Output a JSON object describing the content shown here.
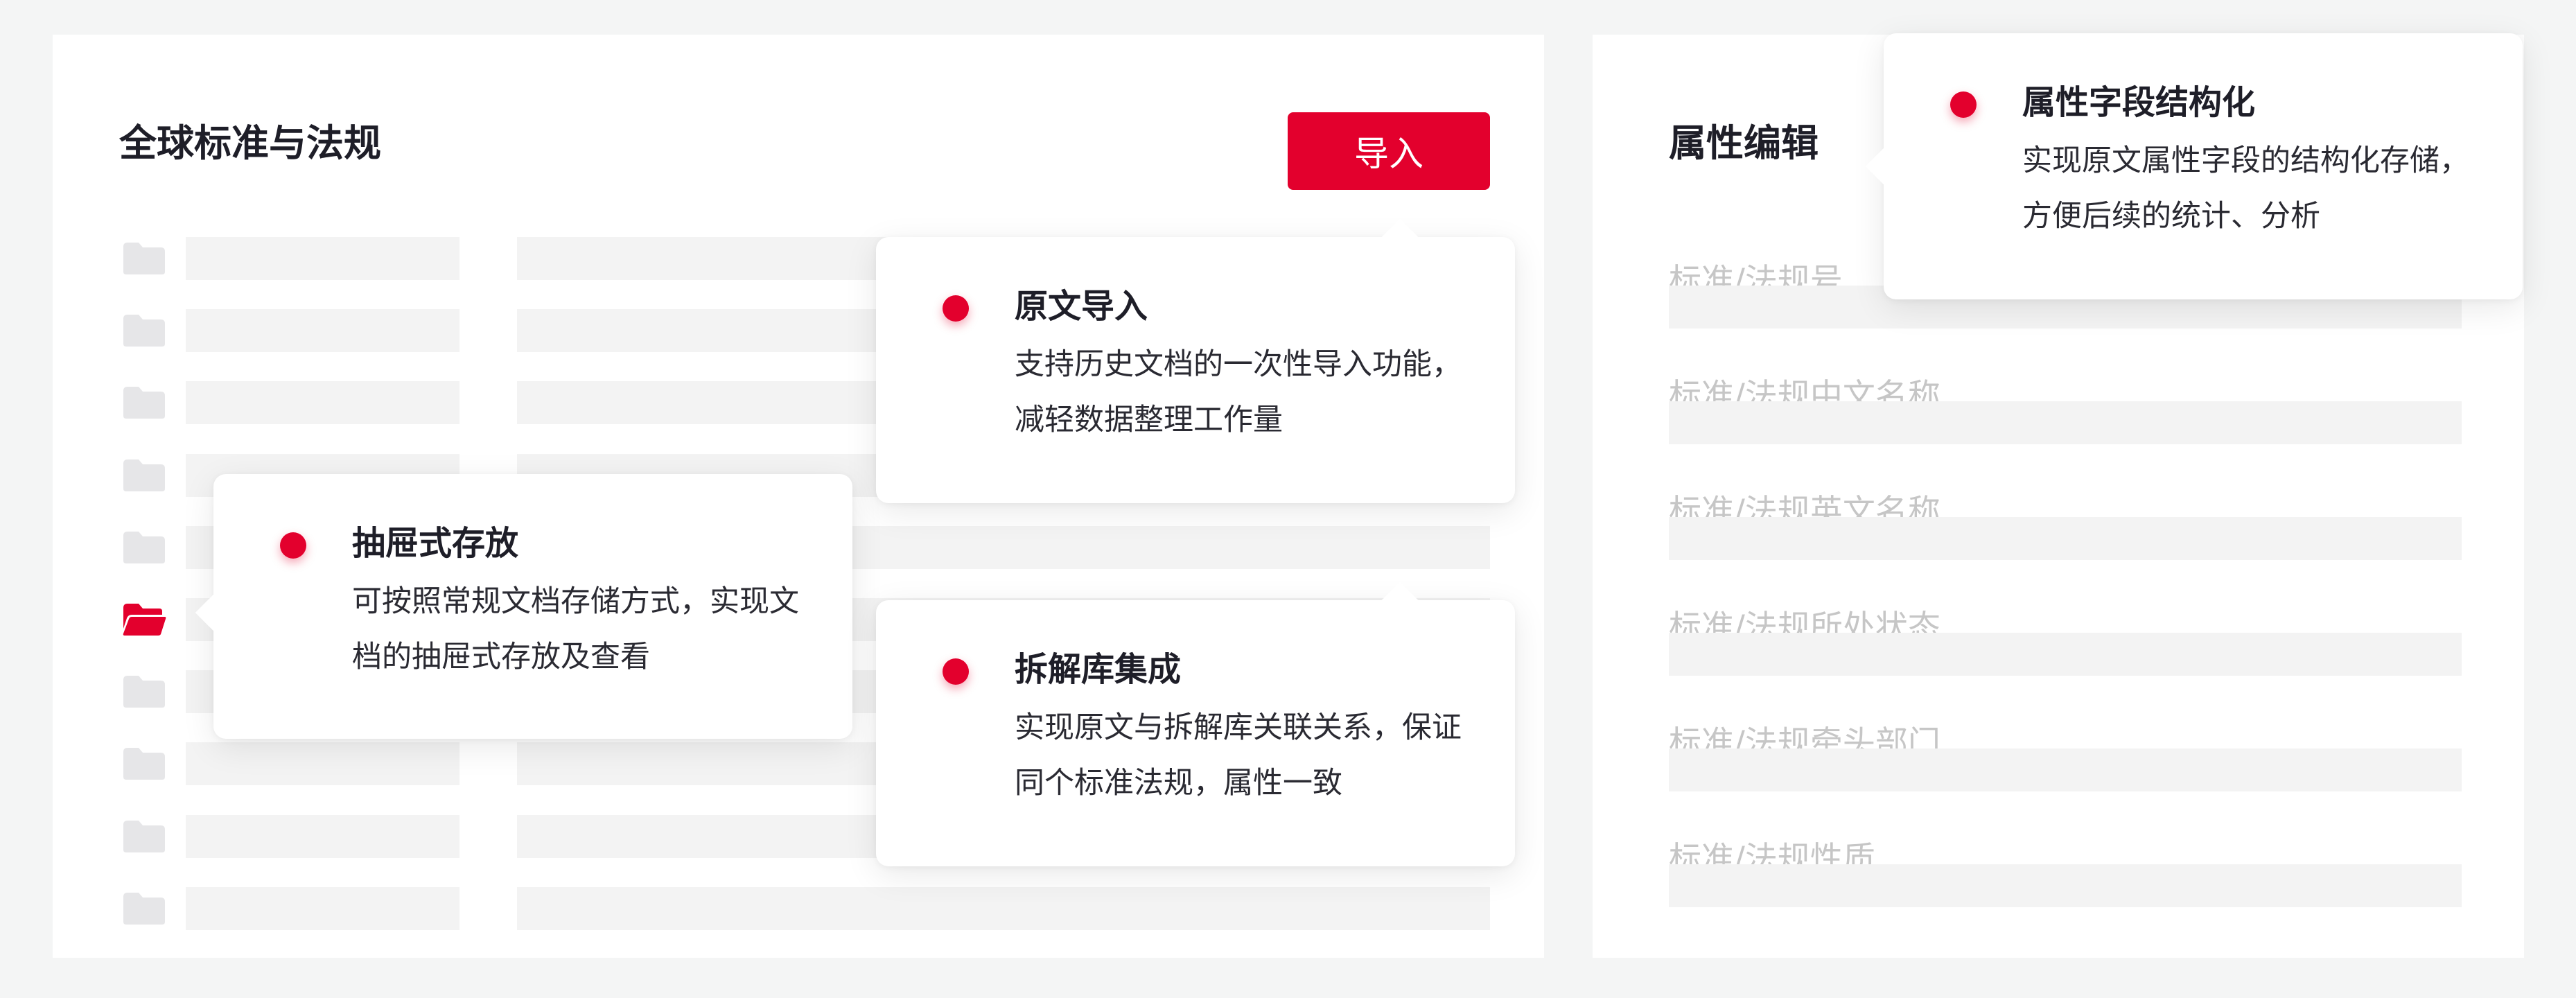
{
  "left_panel": {
    "title": "全球标准与法规",
    "import_button": "导入",
    "row_count": 10,
    "open_folder_index": 5
  },
  "right_panel": {
    "title": "属性编辑",
    "fields": [
      "标准/法规号",
      "标准/法规中文名称",
      "标准/法规英文名称",
      "标准/法规所处状态",
      "标准/法规牵头部门",
      "标准/法规性质"
    ]
  },
  "callouts": {
    "import": {
      "title": "原文导入",
      "desc": "支持历史文档的一次性导入功能，减轻数据整理工作量"
    },
    "drawer": {
      "title": "抽屉式存放",
      "desc": "可按照常规文档存储方式，实现文档的抽屉式存放及查看"
    },
    "integration": {
      "title": "拆解库集成",
      "desc": "实现原文与拆解库关联关系，保证同个标准法规，属性一致"
    },
    "structure": {
      "title": "属性字段结构化",
      "desc": "实现原文属性字段的结构化存储，方便后续的统计、分析"
    }
  },
  "colors": {
    "accent": "#e3002d",
    "background": "#f4f5f5",
    "panel": "#ffffff",
    "placeholder_bar": "#f3f3f3",
    "closed_folder": "#e6e6e8",
    "open_folder": "#e3002d",
    "field_label": "#c6c6c6"
  },
  "icons": {
    "closed_folder": "folder-icon",
    "open_folder": "folder-open-icon",
    "bullet": "red-dot-icon"
  }
}
